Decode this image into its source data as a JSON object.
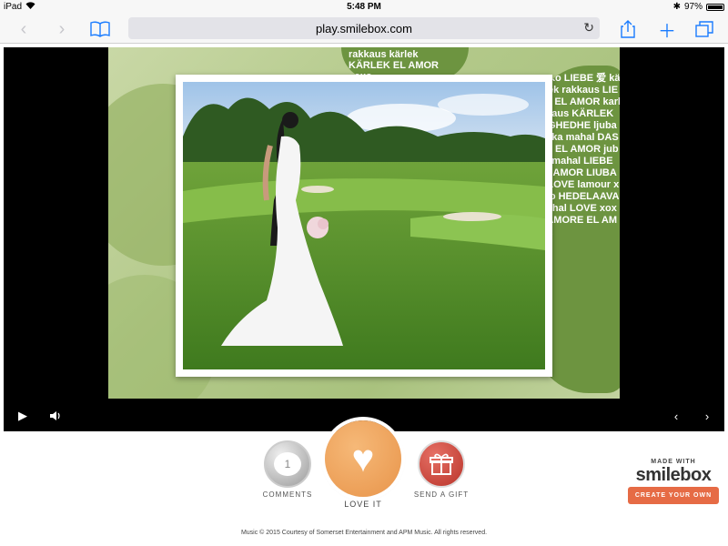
{
  "status_bar": {
    "device": "iPad",
    "time": "5:48 PM",
    "battery": "97%"
  },
  "browser": {
    "url": "play.smilebox.com"
  },
  "slideshow": {
    "word_cloud_text": "xoxo LIEBE 爱 käNlek rakkaus LIEBE EL AMOR karlek aus KÄRLEK HIGHEDHE ljuba laska mahal DASHU EL AMOR jubav mahal LIEBE EL AMOR LIUBAV LOVE lamour xoxo HEDELAAVA mahal LOVE xoxo AMORE EL AMOR",
    "word_cloud_top": "rakkaus kärlek KÄRLEK EL AMOR xoxo"
  },
  "actions": {
    "comments_count": "1",
    "comments_label": "COMMENTS",
    "love_label": "LOVE IT",
    "gift_label": "SEND A GIFT"
  },
  "brand": {
    "made_with": "MADE WITH",
    "logo": "smilebox",
    "create_label": "CREATE YOUR OWN"
  },
  "footer": {
    "credit": "Music © 2015 Courtesy of Somerset Entertainment and APM Music. All rights reserved."
  },
  "icons": {
    "back": "chevron-left-icon",
    "forward": "chevron-right-icon",
    "bookmarks": "book-icon",
    "share": "share-icon",
    "new_tab": "plus-icon",
    "tabs": "tabs-icon",
    "play": "play-icon",
    "volume": "speaker-icon",
    "prev": "chevron-left-icon",
    "next": "chevron-right-icon",
    "heart": "heart-icon",
    "gift": "gift-icon",
    "comment": "speech-bubble-icon"
  }
}
